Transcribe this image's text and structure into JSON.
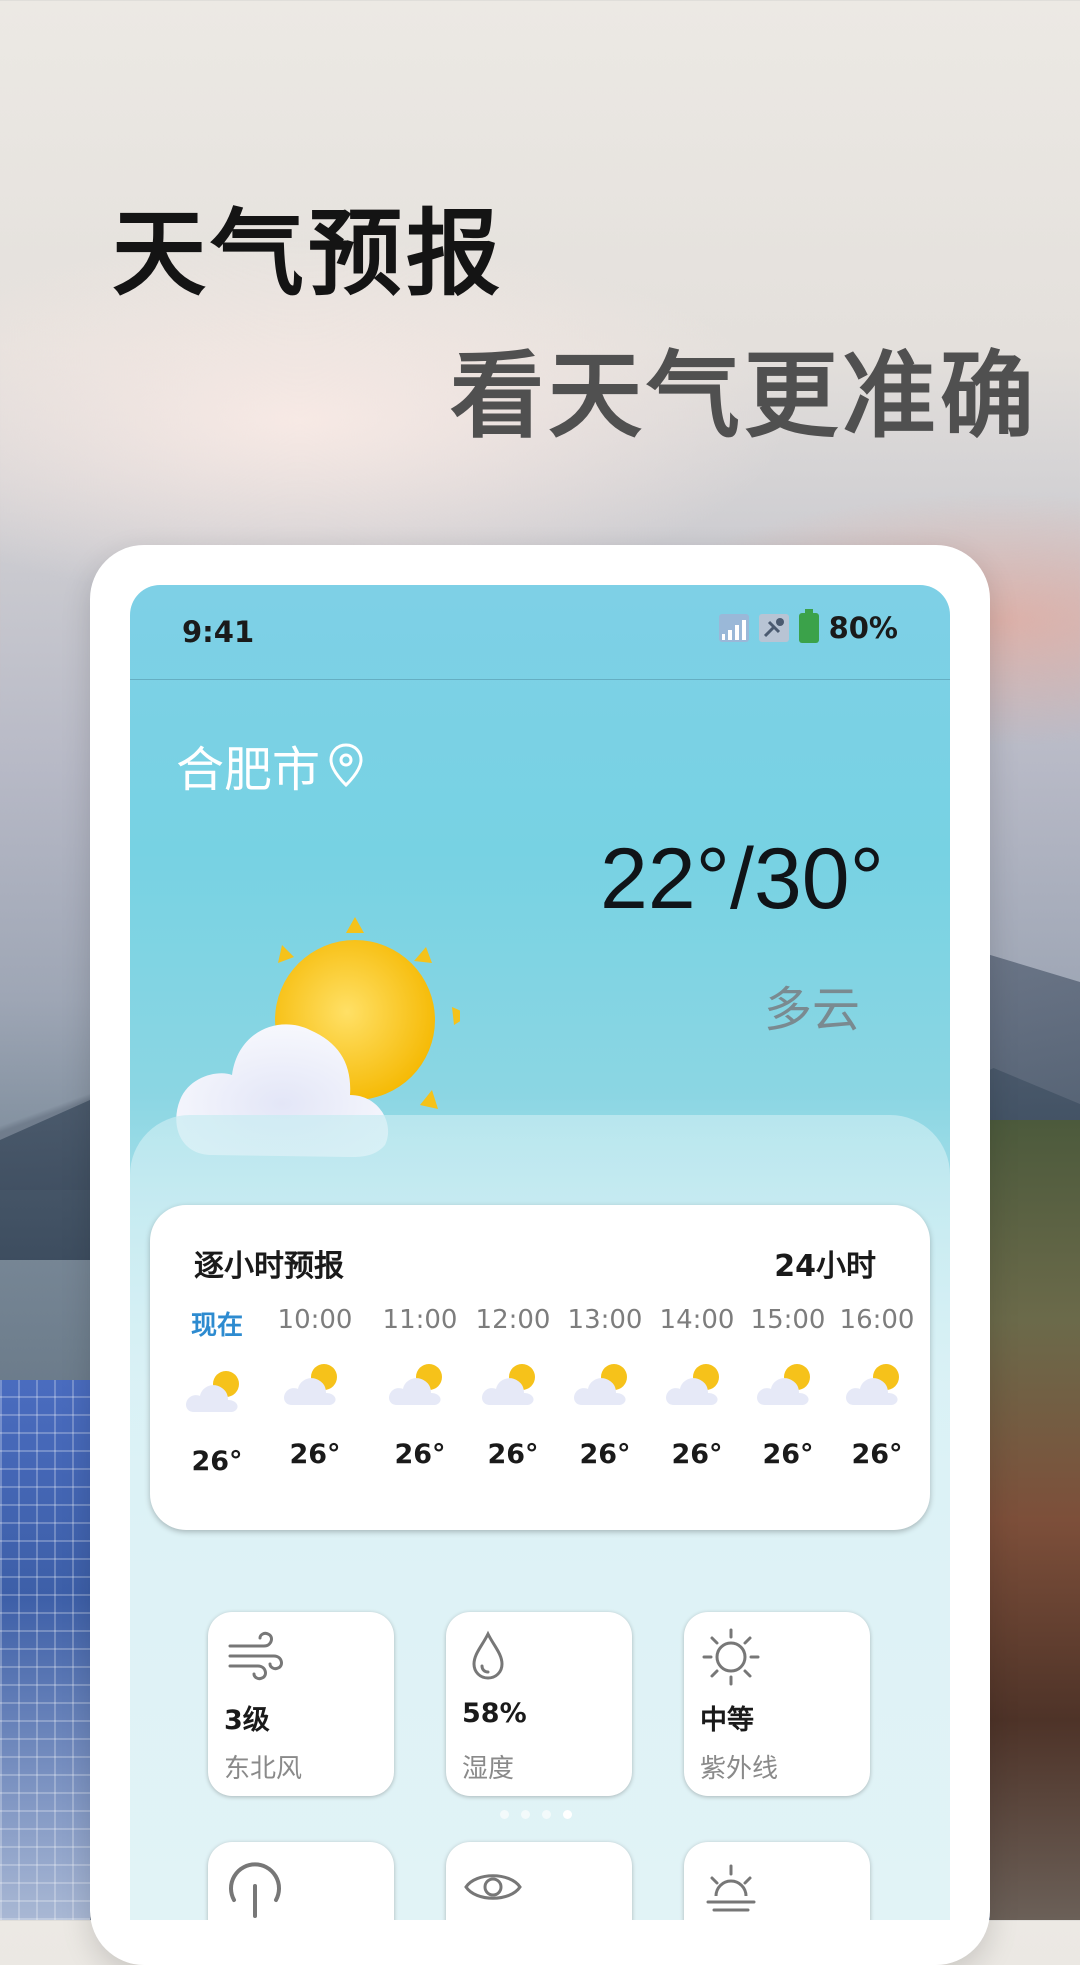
{
  "promo": {
    "headline": "天气预报",
    "subheadline": "看天气更准确"
  },
  "status_bar": {
    "time": "9:41",
    "battery": "80%",
    "icons": [
      "signal-icon",
      "satellite-icon",
      "battery-icon"
    ]
  },
  "location": {
    "city": "合肥市",
    "icon": "location-pin-icon"
  },
  "today": {
    "temp_range": "22°/30°",
    "condition": "多云",
    "icon": "partly-cloudy-icon"
  },
  "hourly": {
    "title": "逐小时预报",
    "range_label": "24小时",
    "hours": [
      {
        "time": "现在",
        "temp": "26°",
        "is_now": true
      },
      {
        "time": "10:00",
        "temp": "26°"
      },
      {
        "time": "11:00",
        "temp": "26°"
      },
      {
        "time": "12:00",
        "temp": "26°"
      },
      {
        "time": "13:00",
        "temp": "26°"
      },
      {
        "time": "14:00",
        "temp": "26°"
      },
      {
        "time": "15:00",
        "temp": "26°"
      },
      {
        "time": "16:00",
        "temp": "26°"
      }
    ]
  },
  "details": [
    {
      "value": "3级",
      "label": "东北风",
      "icon": "wind-icon"
    },
    {
      "value": "58%",
      "label": "湿度",
      "icon": "humidity-drop-icon"
    },
    {
      "value": "中等",
      "label": "紫外线",
      "icon": "sun-uv-icon"
    }
  ],
  "details_row2_icons": [
    "pressure-gauge-icon",
    "visibility-eye-icon",
    "sunrise-icon"
  ],
  "pager": {
    "count": 4,
    "active_index": 3
  },
  "colors": {
    "screen_top": "#7ed0e6",
    "now_label": "#2d8bd0",
    "sun": "#f6c21a"
  }
}
